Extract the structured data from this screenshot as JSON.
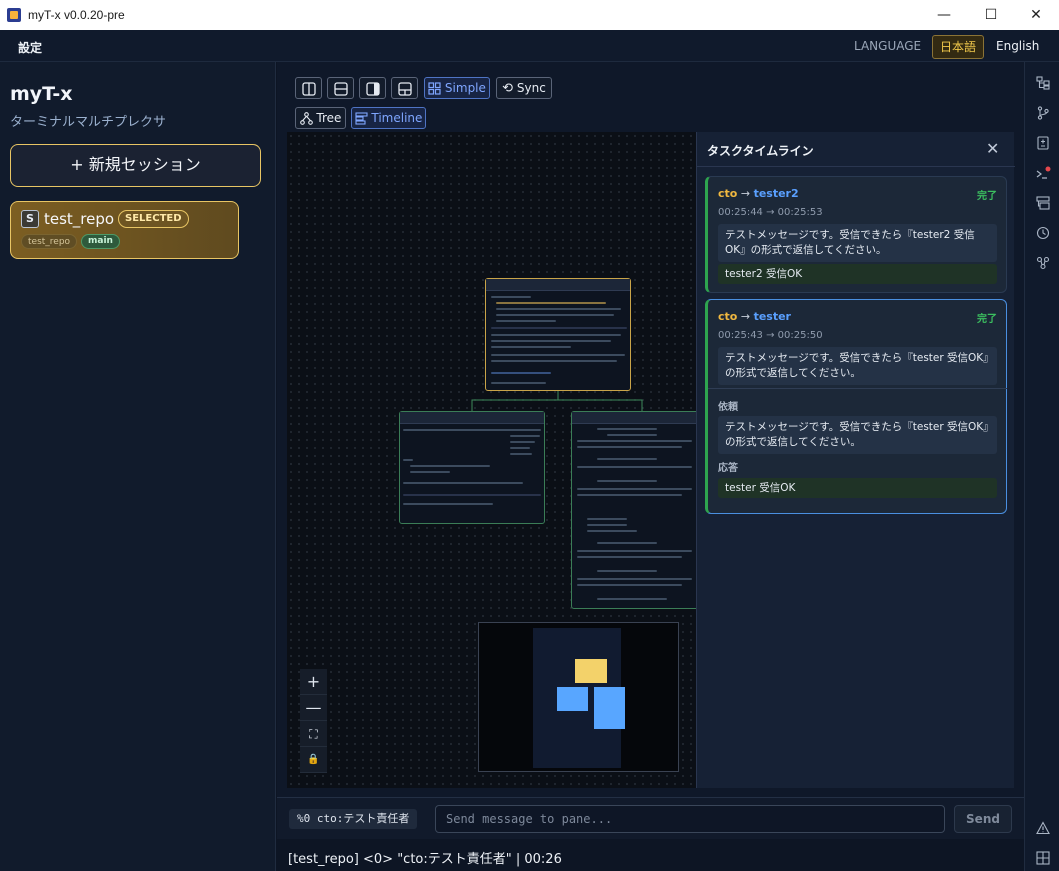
{
  "window": {
    "title": "myT-x v0.0.20-pre",
    "minimize": "—",
    "maximize": "☐",
    "close": "✕"
  },
  "menu": {
    "settings": "設定",
    "language_label": "LANGUAGE",
    "languages": [
      "日本語",
      "English"
    ],
    "active_language": "日本語"
  },
  "sidebar": {
    "app_name": "myT-x",
    "subtitle": "ターミナルマルチプレクサ",
    "new_session": "+ 新規セッション",
    "session": {
      "badge": "S",
      "name": "test_repo",
      "selected_label": "SELECTED",
      "repo_tag": "test_repo",
      "branch_tag": "main"
    }
  },
  "toolbar": {
    "simple": "Simple",
    "sync": "Sync",
    "tree": "Tree",
    "timeline": "Timeline"
  },
  "zoom": {
    "in": "+",
    "out": "—",
    "fit": "⛶",
    "lock": "🔒"
  },
  "timeline": {
    "title": "タスクタイムライン",
    "close": "✕",
    "tasks": [
      {
        "from": "cto",
        "arrow": " → ",
        "to": "tester2",
        "status": "完了",
        "time": "00:25:44 → 00:25:53",
        "message": "テストメッセージです。受信できたら『tester2 受信OK』の形式で返信してください。",
        "response": "tester2 受信OK"
      },
      {
        "from": "cto",
        "arrow": " → ",
        "to": "tester",
        "status": "完了",
        "time": "00:25:43 → 00:25:50",
        "message": "テストメッセージです。受信できたら『tester 受信OK』の形式で返信してください。",
        "request_label": "依頼",
        "request": "テストメッセージです。受信できたら『tester 受信OK』の形式で返信してください。",
        "response_label": "応答",
        "response": "tester 受信OK"
      }
    ]
  },
  "input": {
    "pane_tag": "%0 cto:テスト責任者",
    "placeholder": "Send message to pane...",
    "send": "Send"
  },
  "status_line": "[test_repo] <0> \"cto:テスト責任者\" | 00:26",
  "icons": [
    "hierarchy-icon",
    "git-branch-icon",
    "diff-icon",
    "terminal-alert-icon",
    "layout-icon",
    "history-icon",
    "mcp-icon",
    "warning-icon",
    "grid-icon"
  ],
  "colors": {
    "accent_gold": "#e8c564",
    "accent_blue": "#4f74c4",
    "success_green": "#2ea44f"
  }
}
